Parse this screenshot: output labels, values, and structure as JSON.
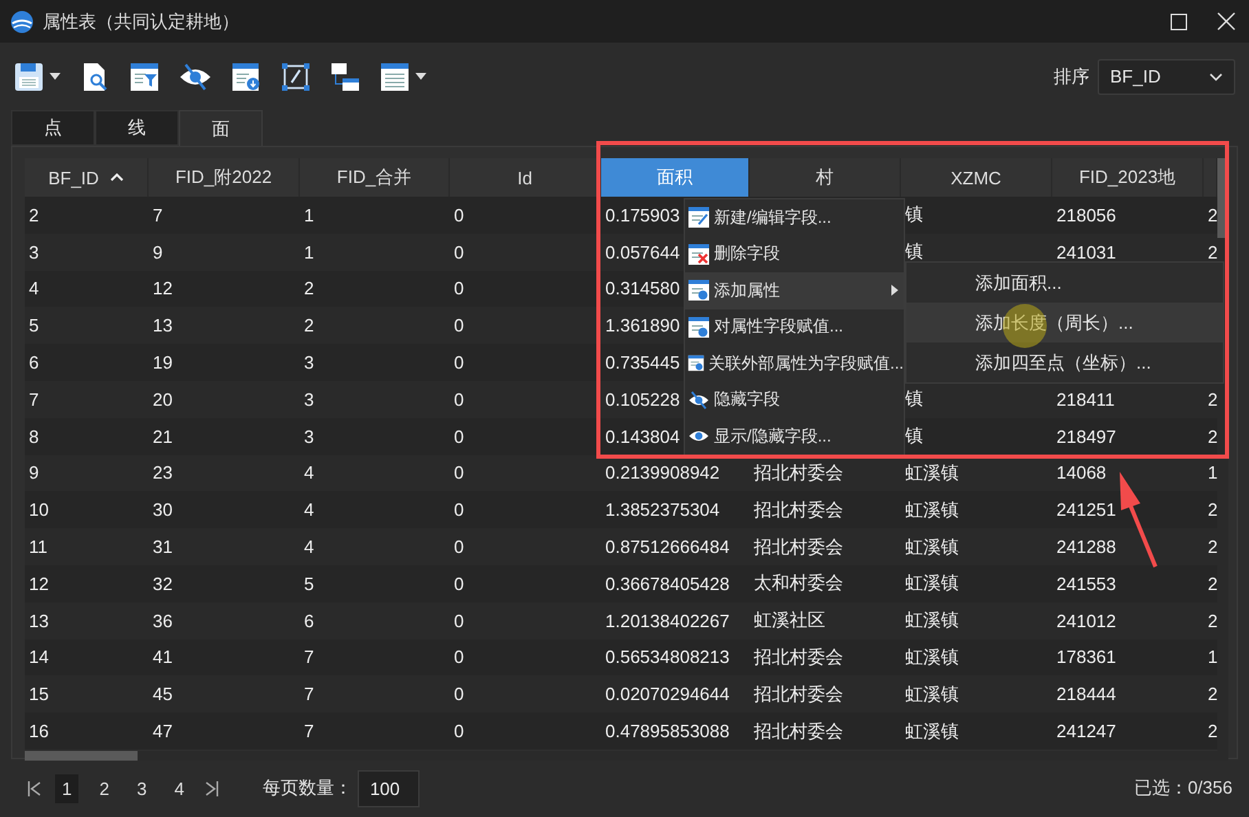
{
  "window": {
    "title": "属性表（共同认定耕地）"
  },
  "toolbar": {
    "sort_label": "排序",
    "sort_field": "BF_ID"
  },
  "tabs": [
    {
      "label": "点",
      "selected": false
    },
    {
      "label": "线",
      "selected": false
    },
    {
      "label": "面",
      "selected": true
    }
  ],
  "table": {
    "columns": [
      {
        "label": "BF_ID",
        "sorted": true,
        "selected": false
      },
      {
        "label": "FID_附2022",
        "sorted": false,
        "selected": false
      },
      {
        "label": "FID_合并",
        "sorted": false,
        "selected": false
      },
      {
        "label": "Id",
        "sorted": false,
        "selected": false
      },
      {
        "label": "面积",
        "sorted": false,
        "selected": true
      },
      {
        "label": "村",
        "sorted": false,
        "selected": false
      },
      {
        "label": "XZMC",
        "sorted": false,
        "selected": false
      },
      {
        "label": "FID_2023地",
        "sorted": false,
        "selected": false
      },
      {
        "sorted": false,
        "selected": false
      }
    ],
    "rows": [
      [
        "2",
        "7",
        "1",
        "0",
        "0.175903",
        null,
        "镇",
        "218056",
        "2"
      ],
      [
        "3",
        "9",
        "1",
        "0",
        "0.057644",
        null,
        "镇",
        "241031",
        "2"
      ],
      [
        "4",
        "12",
        "2",
        "0",
        "0.314580",
        null,
        null,
        null,
        null
      ],
      [
        "5",
        "13",
        "2",
        "0",
        "1.361890",
        null,
        null,
        null,
        null
      ],
      [
        "6",
        "19",
        "3",
        "0",
        "0.735445",
        null,
        null,
        null,
        null
      ],
      [
        "7",
        "20",
        "3",
        "0",
        "0.105228",
        null,
        "镇",
        "218411",
        "2"
      ],
      [
        "8",
        "21",
        "3",
        "0",
        "0.143804",
        null,
        "镇",
        "218497",
        "2"
      ],
      [
        "9",
        "23",
        "4",
        "0",
        "0.2139908942",
        "招北村委会",
        "虹溪镇",
        "14068",
        "1"
      ],
      [
        "10",
        "30",
        "4",
        "0",
        "1.3852375304",
        "招北村委会",
        "虹溪镇",
        "241251",
        "2"
      ],
      [
        "11",
        "31",
        "4",
        "0",
        "0.87512666484",
        "招北村委会",
        "虹溪镇",
        "241288",
        "2"
      ],
      [
        "12",
        "32",
        "5",
        "0",
        "0.36678405428",
        "太和村委会",
        "虹溪镇",
        "241553",
        "2"
      ],
      [
        "13",
        "36",
        "6",
        "0",
        "1.20138402267",
        "虹溪社区",
        "虹溪镇",
        "241012",
        "2"
      ],
      [
        "14",
        "41",
        "7",
        "0",
        "0.56534808213",
        "招北村委会",
        "虹溪镇",
        "178361",
        "1"
      ],
      [
        "15",
        "45",
        "7",
        "0",
        "0.02070294644",
        "招北村委会",
        "虹溪镇",
        "218444",
        "2"
      ],
      [
        "16",
        "47",
        "7",
        "0",
        "0.47895853088",
        "招北村委会",
        "虹溪镇",
        "241247",
        "2"
      ]
    ]
  },
  "context_menu": {
    "items": [
      {
        "label": "新建/编辑字段...",
        "kind": "edit",
        "selected": false,
        "has_submenu": false
      },
      {
        "label": "删除字段",
        "kind": "delete",
        "selected": false,
        "has_submenu": false
      },
      {
        "label": "添加属性",
        "kind": "add",
        "selected": true,
        "has_submenu": true
      },
      {
        "label": "对属性字段赋值...",
        "kind": "assign",
        "selected": false,
        "has_submenu": false
      },
      {
        "label": "关联外部属性为字段赋值...",
        "kind": "assign",
        "selected": false,
        "has_submenu": false
      },
      {
        "label": "隐藏字段",
        "kind": "hide",
        "selected": false,
        "has_submenu": false
      },
      {
        "label": "显示/隐藏字段...",
        "kind": "show",
        "selected": false,
        "has_submenu": false
      }
    ]
  },
  "submenu": {
    "items": [
      {
        "label": "添加面积...",
        "selected": false
      },
      {
        "label": "添加长度（周长）...",
        "selected": true
      },
      {
        "label": "添加四至点（坐标）...",
        "selected": false
      }
    ]
  },
  "pagination": {
    "pages": [
      {
        "label": "1",
        "selected": true
      },
      {
        "label": "2",
        "selected": false
      },
      {
        "label": "3",
        "selected": false
      },
      {
        "label": "4",
        "selected": false
      }
    ],
    "page_size_label": "每页数量：",
    "page_size": "100"
  },
  "status": "已选：0/356"
}
